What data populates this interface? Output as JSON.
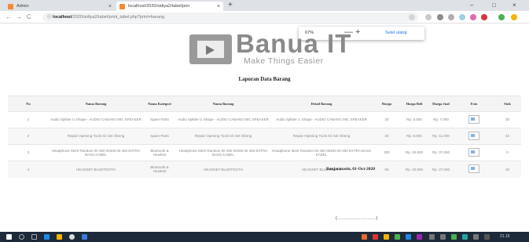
{
  "browser": {
    "tabs": [
      {
        "label": "Admin",
        "close": "×"
      },
      {
        "label": "localhost/2020/sidiya2/tabel/prin",
        "close": "×"
      }
    ],
    "new_tab": "+",
    "window_controls": {
      "minimize": "–",
      "maximize": "□",
      "close": "×"
    },
    "nav": {
      "back": "←",
      "forward": "→",
      "reload": "C"
    },
    "address": {
      "host": "localhost",
      "path": "/2020/sidiya2/tabel/print_tabel.php?print=barang",
      "info": "ⓘ"
    },
    "zoom_popup": {
      "percent": "67%",
      "minus": "—",
      "plus": "+",
      "reset": "Setel ulang"
    }
  },
  "logo": {
    "word": "Banua  IT",
    "tagline": "Make Things Easier"
  },
  "report": {
    "title": "Laporan Data Barang",
    "headers": [
      "No",
      "Nama Barang",
      "Nama Kategori",
      "Nama Barang",
      "Detail Barang",
      "Harga",
      "Harga Beli",
      "Harga Jual",
      "Foto",
      "Stok"
    ],
    "rows": [
      {
        "no": "1",
        "nama": "Audio Splitter U Shape - AUDIO CABANG MIC SPEAKER",
        "kategori": "Spare Parts",
        "nama2": "Audio Splitter U Shape - AUDIO CABANG MIC SPEAKER",
        "detail": "Audio Splitter U Shape - AUDIO CABANG MIC SPEAKER",
        "harga": "20",
        "beli": "Rp. 5.000",
        "jual": "Rp. 7.000",
        "stok": "30"
      },
      {
        "no": "2",
        "nama": "Repair Opening Tools Kit Set Obeng",
        "kategori": "Spare Parts",
        "nama2": "Repair Opening Tools Kit Set Obeng",
        "detail": "Repair Opening Tools Kit Set Obeng",
        "harga": "20",
        "beli": "Rp. 8.000",
        "jual": "Rp. 11.000",
        "stok": "43"
      },
      {
        "no": "3",
        "nama": "Headphone Merk Random 00 450 00400 00 450 EXTRA BASS KABEL",
        "kategori": "Bluetooth & Headset",
        "nama2": "Headphone Merk Random 00 450 00400 00 450 EXTRA BASS KABEL",
        "detail": "Headphone Merk Random 00 450 00400 00 450 EXTRA BASS KABEL",
        "harga": "300",
        "beli": "Rp. 20.000",
        "jual": "Rp. 37.000",
        "stok": "0"
      },
      {
        "no": "4",
        "nama": "HEADSET BLUETOOTH",
        "kategori": "Bluetooth & Headset",
        "nama2": "HEADSET BLUETOOTH",
        "detail": "HEADSET BLUETOOTH",
        "harga": "50",
        "beli": "Rp. 20.000",
        "jual": "Rp. 27.000",
        "stok": "20"
      }
    ],
    "city_date": "Banjarmasin, 01-Oct-2020",
    "signature_line": "(...........................)"
  },
  "taskbar": {
    "clock": "21.15"
  },
  "colors": {
    "accent": "#f28b32",
    "taskbar": "#1c2a3a",
    "link": "#1a73e8"
  }
}
